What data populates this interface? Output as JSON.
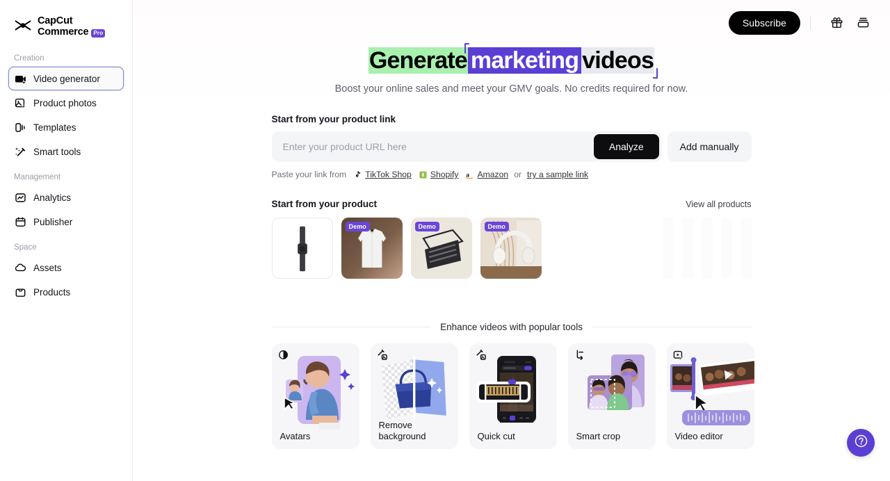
{
  "brand": {
    "line1": "CapCut",
    "line2": "Commerce",
    "badge": "Pro",
    "logo_icon": "capcut-logo-icon"
  },
  "sidebar": {
    "groups": [
      {
        "label": "Creation",
        "items": [
          {
            "label": "Video generator",
            "icon": "video-generator-icon",
            "active": true
          },
          {
            "label": "Product photos",
            "icon": "product-photos-icon",
            "active": false
          },
          {
            "label": "Templates",
            "icon": "templates-icon",
            "active": false
          },
          {
            "label": "Smart tools",
            "icon": "smart-tools-icon",
            "active": false
          }
        ]
      },
      {
        "label": "Management",
        "items": [
          {
            "label": "Analytics",
            "icon": "analytics-icon",
            "active": false
          },
          {
            "label": "Publisher",
            "icon": "publisher-calendar-icon",
            "active": false
          }
        ]
      },
      {
        "label": "Space",
        "items": [
          {
            "label": "Assets",
            "icon": "assets-cloud-icon",
            "active": false
          },
          {
            "label": "Products",
            "icon": "products-bag-icon",
            "active": false
          }
        ]
      }
    ]
  },
  "topbar": {
    "subscribe_label": "Subscribe",
    "gift_icon": "gift-icon",
    "inbox_icon": "inbox-icon"
  },
  "hero": {
    "headline_parts": [
      {
        "text": "Generate",
        "style": "green"
      },
      {
        "text": "marketing",
        "style": "purple"
      },
      {
        "text": "videos",
        "style": "gray"
      }
    ],
    "subhead": "Boost your online sales and meet your GMV goals. No credits required for now.",
    "accent_purple": "#5b3fd4",
    "accent_green": "#a8f0ae",
    "accent_gray": "#e7e9ef"
  },
  "product_link": {
    "title": "Start from your product link",
    "input_value": "",
    "input_placeholder": "Enter your product URL here",
    "analyze_label": "Analyze",
    "add_manually_label": "Add manually",
    "hint_prefix": "Paste your link from",
    "sources": [
      {
        "label": "TikTok Shop",
        "icon": "tiktok-icon"
      },
      {
        "label": "Shopify",
        "icon": "shopify-icon"
      },
      {
        "label": "Amazon",
        "icon": "amazon-icon"
      }
    ],
    "hint_or": "or",
    "sample_link_label": "try a sample link"
  },
  "products": {
    "title": "Start from your product",
    "view_all_label": "View all products",
    "items": [
      {
        "name": "black-watch-strap",
        "demo": false,
        "badge": ""
      },
      {
        "name": "white-dress-shirt",
        "demo": true,
        "badge": "Demo"
      },
      {
        "name": "black-organizer-tray",
        "demo": true,
        "badge": "Demo"
      },
      {
        "name": "white-headphones",
        "demo": true,
        "badge": "Demo"
      }
    ]
  },
  "tools": {
    "section_title": "Enhance videos with popular tools",
    "cards": [
      {
        "label": "Avatars",
        "icon": "avatar-contrast-icon",
        "art": "avatars"
      },
      {
        "label": "Remove background",
        "icon": "magic-image-icon",
        "art": "remove-bg"
      },
      {
        "label": "Quick cut",
        "icon": "magic-image-icon",
        "art": "quick-cut"
      },
      {
        "label": "Smart crop",
        "icon": "crop-icon",
        "art": "smart-crop"
      },
      {
        "label": "Video editor",
        "icon": "video-edit-icon",
        "art": "video-editor"
      }
    ]
  },
  "help": {
    "icon": "question-mark-icon",
    "color": "#5b3fd4"
  }
}
